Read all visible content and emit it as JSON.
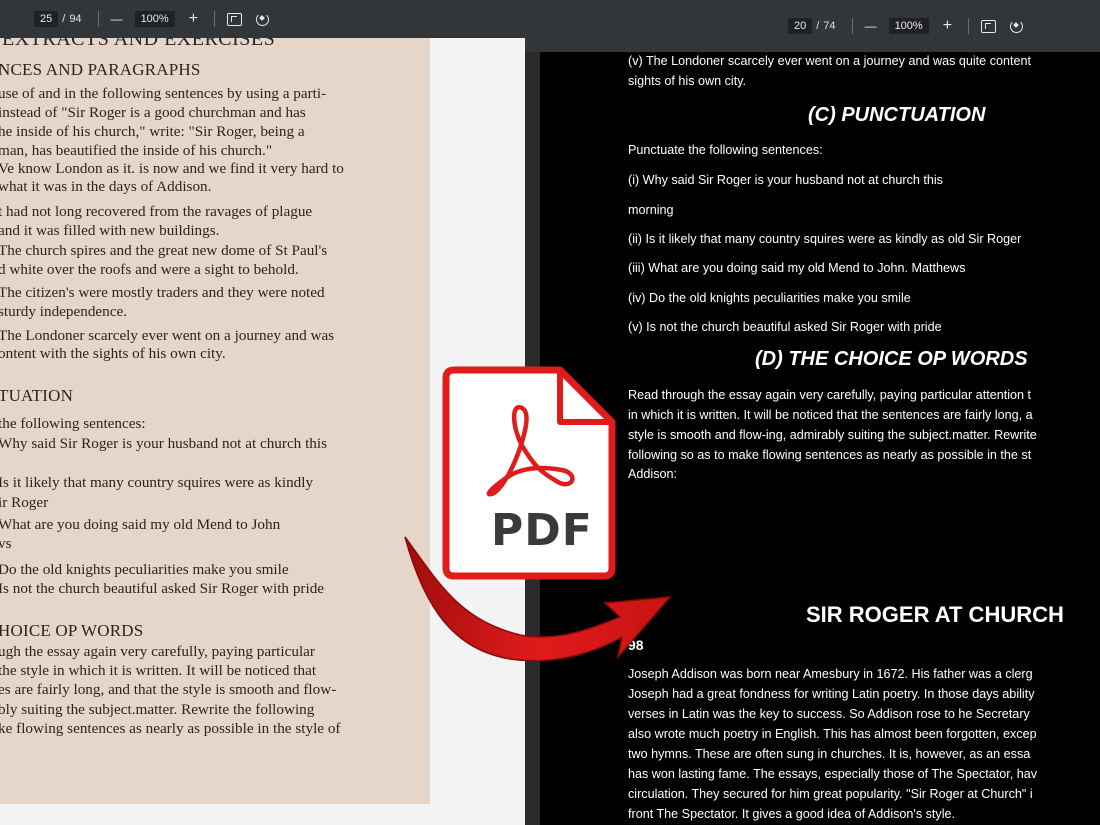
{
  "left_viewer": {
    "toolbar": {
      "page_current": "25",
      "page_sep": "/",
      "page_total": "94",
      "zoom_out": "—",
      "zoom": "100%",
      "zoom_in": "+"
    },
    "page": {
      "title": "EXTRACTS AND EXERCISES",
      "lines": [
        "NCES AND PARAGRAPHS",
        "use of and in the following sentences by using a parti-",
        "instead of \"Sir Roger is a good churchman and has",
        "he inside of his church,\" write: \"Sir Roger, being a",
        "man, has beautified the inside of his church.\"",
        "Ve know London as it. is now and we find it very hard to",
        "what it was in the days of Addison.",
        "t had not long recovered from the ravages of plague",
        "and it was filled with new buildings.",
        "The church spires and the great new dome of St Paul's",
        "d white over the roofs and were a sight to behold.",
        "The citizen's were mostly traders and they were noted",
        "sturdy independence.",
        "The Londoner scarcely ever went on a journey and was",
        "ontent with the sights of his own city.",
        "TUATION",
        "the following sentences:",
        "Why said Sir Roger is your husband not at church this",
        "Is it likely that many country squires were as kindly",
        "ir Roger",
        "What are you doing said my old Mend to John",
        "vs",
        "Do the old knights peculiarities make you smile",
        "Is not the church beautiful asked Sir Roger with pride",
        "HOICE OP WORDS",
        "ugh the essay again very carefully, paying particular",
        "the style in which it is written. It will be noticed that",
        "es are fairly long, and that the style is smooth and flow-",
        "bly suiting the subject.matter. Rewrite the following",
        "ke flowing sentences as nearly as possible in the style of"
      ]
    }
  },
  "right_viewer": {
    "toolbar": {
      "page_current": "20",
      "page_sep": "/",
      "page_total": "74",
      "zoom_out": "—",
      "zoom": "100%",
      "zoom_in": "+"
    },
    "page": {
      "intro_lines": [
        "(v) The Londoner scarcely ever went on a journey and was quite content",
        "sights of his own city."
      ],
      "heading_punctuation": "(C) PUNCTUATION",
      "punctuate_intro": "Punctuate the following sentences:",
      "punct_items": [
        "(i) Why said Sir Roger is your husband not at church this",
        "morning",
        "(ii) Is it likely that many country squires were as kindly as old Sir Roger",
        "(iii) What are you doing said my old Mend to John. Matthews",
        "(iv) Do the old knights peculiarities make you smile",
        "(v) Is not the church beautiful asked Sir Roger with pride"
      ],
      "heading_words": "(D) THE CHOICE OP WORDS",
      "words_lines": [
        "Read through the essay again very carefully, paying particular attention t",
        "in which it is written. It will be noticed that the sentences are fairly long, a",
        "style is smooth and flow-ing, admirably suiting the subject.matter. Rewrite",
        "following so as to make flowing sentences as nearly as possible in the st",
        "Addison:"
      ],
      "heading_sir_roger": "SIR ROGER AT CHURCH",
      "page_number": "98",
      "bio_lines": [
        "Joseph Addison was born near Amesbury in 1672. His father was a clerg",
        "Joseph had a great fondness for writing Latin poetry. In those days ability",
        "verses in Latin was the key to success. So Addison rose to he Secretary",
        "also wrote much poetry in English. This has almost been forgotten, excep",
        "two hymns. These are often sung in churches. It is, however, as an essa",
        "has won lasting fame. The essays, especially those of The Spectator, hav",
        "circulation. They secured for him great popularity. \"Sir Roger at Church\" i",
        "front The Spectator. It gives a good idea of Addison's style."
      ]
    }
  },
  "overlay": {
    "pdf_text": "PDF",
    "icon": "acrobat-pdf-icon",
    "arrow": "curved-arrow-right-icon",
    "colors": {
      "red": "#e01b1b",
      "dark_red": "#b50f0f",
      "badge_bg": "#ffffff"
    }
  }
}
